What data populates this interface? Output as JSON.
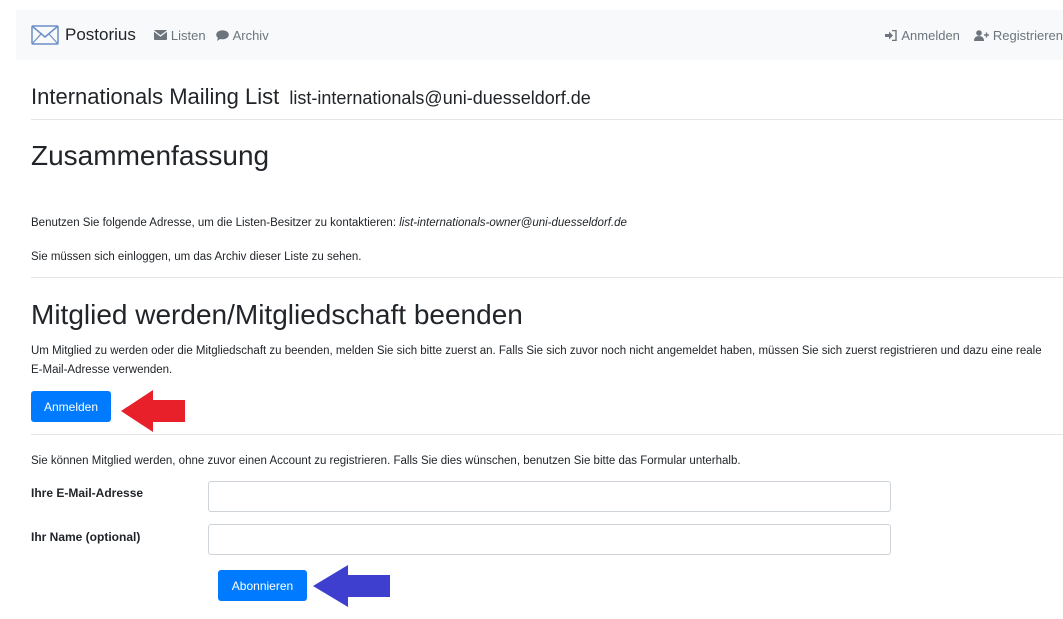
{
  "navbar": {
    "brand": "Postorius",
    "lists_label": "Listen",
    "archive_label": "Archiv",
    "login_label": "Anmelden",
    "register_label": "Registrieren"
  },
  "list": {
    "name": "Internationals Mailing List",
    "address": "list-internationals@uni-duesseldorf.de"
  },
  "summary": {
    "heading": "Zusammenfassung",
    "contact_text": "Benutzen Sie folgende Adresse, um die Listen-Besitzer zu kontaktieren: ",
    "owner_address": "list-internationals-owner@uni-duesseldorf.de",
    "archive_notice": "Sie müssen sich einloggen, um das Archiv dieser Liste zu sehen."
  },
  "membership": {
    "heading": "Mitglied werden/Mitgliedschaft beenden",
    "intro": "Um Mitglied zu werden oder die Mitgliedschaft zu beenden, melden Sie sich bitte zuerst an. Falls Sie sich zuvor noch nicht angemeldet haben, müssen Sie sich zuerst registrieren und dazu eine reale E-Mail-Adresse verwenden.",
    "login_button": "Anmelden",
    "anonymous_text": "Sie können Mitglied werden, ohne zuvor einen Account zu registrieren. Falls Sie dies wünschen, benutzen Sie bitte das Formular unterhalb.",
    "email_label": "Ihre E-Mail-Adresse",
    "email_value": "",
    "name_label": "Ihr Name (optional)",
    "name_value": "",
    "subscribe_button": "Abonnieren"
  },
  "colors": {
    "primary": "#007bff",
    "annotation_red": "#e8202a",
    "annotation_blue": "#3f3fcf"
  }
}
